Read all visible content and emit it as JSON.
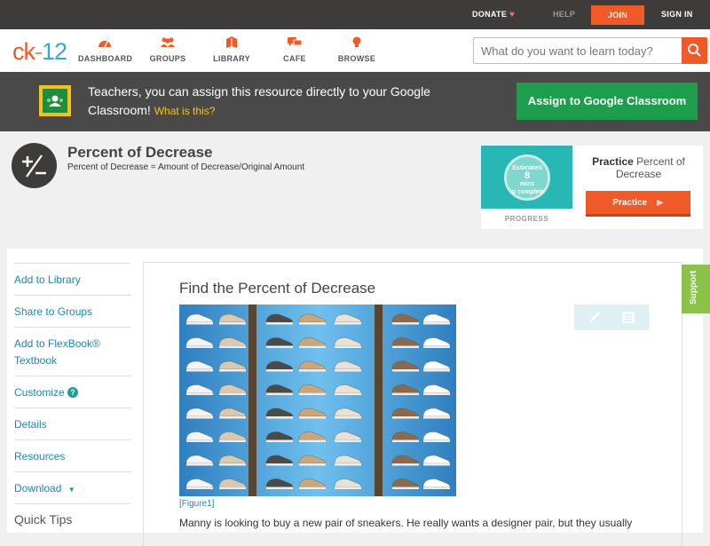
{
  "topbar": {
    "donate": "DONATE",
    "help": "HELP",
    "join": "JOIN",
    "signin": "SIGN IN"
  },
  "logo": {
    "ck": "ck",
    "dash": "-",
    "num": "12"
  },
  "nav": [
    {
      "label": "DASHBOARD",
      "icon": "dashboard-icon"
    },
    {
      "label": "GROUPS",
      "icon": "groups-icon"
    },
    {
      "label": "LIBRARY",
      "icon": "library-icon"
    },
    {
      "label": "CAFE",
      "icon": "cafe-icon"
    },
    {
      "label": "BROWSE",
      "icon": "lightbulb-icon"
    }
  ],
  "search": {
    "placeholder": "What do you want to learn today?"
  },
  "classroom": {
    "message": "Teachers, you can assign this resource directly to your Google Classroom!",
    "what_link": "What is this?",
    "assign_button": "Assign to Google Classroom"
  },
  "lesson": {
    "title": "Percent of Decrease",
    "subtitle": "Percent of Decrease = Amount of Decrease/Original Amount"
  },
  "practice": {
    "estimate_line1": "Estimated",
    "estimate_mins": "8",
    "estimate_unit": "mins",
    "estimate_line3": "to complete",
    "progress_label": "PROGRESS",
    "title_bold": "Practice",
    "title_rest": "Percent of Decrease",
    "button": "Practice"
  },
  "sidebar": {
    "items": [
      {
        "label": "Add to Library"
      },
      {
        "label": "Share to Groups"
      },
      {
        "label": "Add to FlexBook® Textbook"
      },
      {
        "label": "Customize"
      },
      {
        "label": "Details"
      },
      {
        "label": "Resources"
      },
      {
        "label": "Download"
      }
    ],
    "quick_tips": "Quick Tips"
  },
  "content": {
    "heading": "Find the Percent of Decrease",
    "figure_caption": "[Figure1]",
    "paragraph": "Manny is looking to buy a new pair of sneakers. He really wants a designer pair, but they usually"
  },
  "support": {
    "label": "Support"
  },
  "colors": {
    "brand_orange": "#f05a28",
    "brand_green": "#9abe38",
    "brand_blue": "#35aad6",
    "google_green": "#1e9e4d",
    "link_blue": "#1a87b8",
    "support_green": "#8bc34a"
  }
}
